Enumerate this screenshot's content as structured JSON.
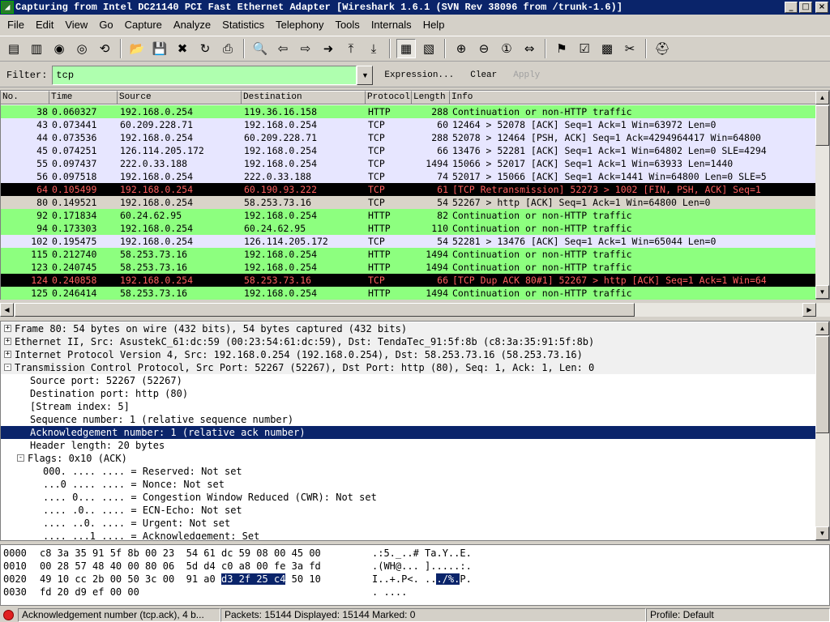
{
  "window": {
    "title": "Capturing from Intel DC21140 PCI Fast Ethernet Adapter   [Wireshark 1.6.1  (SVN Rev 38096 from /trunk-1.6)]",
    "controls": [
      "_",
      "□",
      "×"
    ]
  },
  "menu": [
    "File",
    "Edit",
    "View",
    "Go",
    "Capture",
    "Analyze",
    "Statistics",
    "Telephony",
    "Tools",
    "Internals",
    "Help"
  ],
  "toolbar": {
    "icons": [
      {
        "name": "interfaces-icon",
        "glyph": "▤"
      },
      {
        "name": "capture-options-icon",
        "glyph": "▥"
      },
      {
        "name": "start-capture-icon",
        "glyph": "◉"
      },
      {
        "name": "stop-capture-icon",
        "glyph": "◎"
      },
      {
        "name": "restart-capture-icon",
        "glyph": "⟲"
      },
      {
        "name": "sep"
      },
      {
        "name": "open-file-icon",
        "glyph": "📂"
      },
      {
        "name": "save-file-icon",
        "glyph": "💾"
      },
      {
        "name": "close-file-icon",
        "glyph": "✖"
      },
      {
        "name": "reload-icon",
        "glyph": "↻"
      },
      {
        "name": "print-icon",
        "glyph": "⎙"
      },
      {
        "name": "sep"
      },
      {
        "name": "find-packet-icon",
        "glyph": "🔍"
      },
      {
        "name": "go-back-icon",
        "glyph": "⇦"
      },
      {
        "name": "go-forward-icon",
        "glyph": "⇨"
      },
      {
        "name": "go-to-packet-icon",
        "glyph": "➜"
      },
      {
        "name": "go-first-icon",
        "glyph": "⤒"
      },
      {
        "name": "go-last-icon",
        "glyph": "⤓"
      },
      {
        "name": "sep"
      },
      {
        "name": "colorize-icon",
        "glyph": "▦",
        "active": true
      },
      {
        "name": "auto-scroll-icon",
        "glyph": "▧"
      },
      {
        "name": "sep"
      },
      {
        "name": "zoom-in-icon",
        "glyph": "⊕"
      },
      {
        "name": "zoom-out-icon",
        "glyph": "⊖"
      },
      {
        "name": "zoom-normal-icon",
        "glyph": "①"
      },
      {
        "name": "resize-columns-icon",
        "glyph": "⇔"
      },
      {
        "name": "sep"
      },
      {
        "name": "capture-filters-icon",
        "glyph": "⚑"
      },
      {
        "name": "display-filters-icon",
        "glyph": "☑"
      },
      {
        "name": "coloring-rules-icon",
        "glyph": "▩"
      },
      {
        "name": "preferences-icon",
        "glyph": "✂"
      },
      {
        "name": "sep"
      },
      {
        "name": "help-icon",
        "glyph": "⛑"
      }
    ]
  },
  "filter": {
    "label": "Filter:",
    "value": "tcp",
    "expression": "Expression...",
    "clear": "Clear",
    "apply": "Apply"
  },
  "columns": [
    "No.",
    "Time",
    "Source",
    "Destination",
    "Protocol",
    "Length",
    "Info"
  ],
  "packets": [
    {
      "no": "38",
      "time": "0.060327",
      "src": "192.168.0.254",
      "dst": "119.36.16.158",
      "proto": "HTTP",
      "len": "288",
      "info": "Continuation or non-HTTP traffic",
      "style": "http"
    },
    {
      "no": "43",
      "time": "0.073441",
      "src": "60.209.228.71",
      "dst": "192.168.0.254",
      "proto": "TCP",
      "len": "60",
      "info": "12464 > 52078 [ACK] Seq=1 Ack=1 Win=63972 Len=0",
      "style": "tcp"
    },
    {
      "no": "44",
      "time": "0.073536",
      "src": "192.168.0.254",
      "dst": "60.209.228.71",
      "proto": "TCP",
      "len": "288",
      "info": "52078 > 12464 [PSH, ACK] Seq=1 Ack=4294964417 Win=64800",
      "style": "tcp"
    },
    {
      "no": "45",
      "time": "0.074251",
      "src": "126.114.205.172",
      "dst": "192.168.0.254",
      "proto": "TCP",
      "len": "66",
      "info": "13476 > 52281 [ACK] Seq=1 Ack=1 Win=64802 Len=0 SLE=4294",
      "style": "tcp"
    },
    {
      "no": "55",
      "time": "0.097437",
      "src": "222.0.33.188",
      "dst": "192.168.0.254",
      "proto": "TCP",
      "len": "1494",
      "info": "15066 > 52017 [ACK] Seq=1 Ack=1 Win=63933 Len=1440",
      "style": "tcp"
    },
    {
      "no": "56",
      "time": "0.097518",
      "src": "192.168.0.254",
      "dst": "222.0.33.188",
      "proto": "TCP",
      "len": "74",
      "info": "52017 > 15066 [ACK] Seq=1 Ack=1441 Win=64800 Len=0 SLE=5",
      "style": "tcp"
    },
    {
      "no": "64",
      "time": "0.105499",
      "src": "192.168.0.254",
      "dst": "60.190.93.222",
      "proto": "TCP",
      "len": "61",
      "info": "[TCP Retransmission] 52273 > 1002 [FIN, PSH, ACK] Seq=1",
      "style": "bad"
    },
    {
      "no": "80",
      "time": "0.149521",
      "src": "192.168.0.254",
      "dst": "58.253.73.16",
      "proto": "TCP",
      "len": "54",
      "info": "52267 > http [ACK] Seq=1 Ack=1 Win=64800 Len=0",
      "style": "sel"
    },
    {
      "no": "92",
      "time": "0.171834",
      "src": "60.24.62.95",
      "dst": "192.168.0.254",
      "proto": "HTTP",
      "len": "82",
      "info": "Continuation or non-HTTP traffic",
      "style": "http"
    },
    {
      "no": "94",
      "time": "0.173303",
      "src": "192.168.0.254",
      "dst": "60.24.62.95",
      "proto": "HTTP",
      "len": "110",
      "info": "Continuation or non-HTTP traffic",
      "style": "http"
    },
    {
      "no": "102",
      "time": "0.195475",
      "src": "192.168.0.254",
      "dst": "126.114.205.172",
      "proto": "TCP",
      "len": "54",
      "info": "52281 > 13476 [ACK] Seq=1 Ack=1 Win=65044 Len=0",
      "style": "tcp"
    },
    {
      "no": "115",
      "time": "0.212740",
      "src": "58.253.73.16",
      "dst": "192.168.0.254",
      "proto": "HTTP",
      "len": "1494",
      "info": "Continuation or non-HTTP traffic",
      "style": "http"
    },
    {
      "no": "123",
      "time": "0.240745",
      "src": "58.253.73.16",
      "dst": "192.168.0.254",
      "proto": "HTTP",
      "len": "1494",
      "info": "Continuation or non-HTTP traffic",
      "style": "http"
    },
    {
      "no": "124",
      "time": "0.240858",
      "src": "192.168.0.254",
      "dst": "58.253.73.16",
      "proto": "TCP",
      "len": "66",
      "info": "[TCP Dup ACK 80#1] 52267 > http [ACK] Seq=1 Ack=1 Win=64",
      "style": "bad"
    },
    {
      "no": "125",
      "time": "0.246414",
      "src": "58.253.73.16",
      "dst": "192.168.0.254",
      "proto": "HTTP",
      "len": "1494",
      "info": "Continuation or non-HTTP traffic",
      "style": "http"
    }
  ],
  "details": [
    {
      "text": "Frame 80: 54 bytes on wire (432 bits), 54 bytes captured (432 bits)",
      "level": 0,
      "expander": "+",
      "shade": true
    },
    {
      "text": "Ethernet II, Src: AsustekC_61:dc:59 (00:23:54:61:dc:59), Dst: TendaTec_91:5f:8b (c8:3a:35:91:5f:8b)",
      "level": 0,
      "expander": "+",
      "shade": true
    },
    {
      "text": "Internet Protocol Version 4, Src: 192.168.0.254 (192.168.0.254), Dst: 58.253.73.16 (58.253.73.16)",
      "level": 0,
      "expander": "+",
      "shade": true
    },
    {
      "text": "Transmission Control Protocol, Src Port: 52267 (52267), Dst Port: http (80), Seq: 1, Ack: 1, Len: 0",
      "level": 0,
      "expander": "-",
      "shade": true
    },
    {
      "text": "Source port: 52267 (52267)",
      "level": 1
    },
    {
      "text": "Destination port: http (80)",
      "level": 1
    },
    {
      "text": "[Stream index: 5]",
      "level": 1
    },
    {
      "text": "Sequence number: 1    (relative sequence number)",
      "level": 1
    },
    {
      "text": "Acknowledgement number: 1    (relative ack number)",
      "level": 1,
      "selected": true
    },
    {
      "text": "Header length: 20 bytes",
      "level": 1
    },
    {
      "text": "Flags: 0x10 (ACK)",
      "level": 1,
      "expander": "-"
    },
    {
      "text": "000. .... .... = Reserved: Not set",
      "level": 2
    },
    {
      "text": "...0 .... .... = Nonce: Not set",
      "level": 2
    },
    {
      "text": ".... 0... .... = Congestion Window Reduced (CWR): Not set",
      "level": 2
    },
    {
      "text": ".... .0.. .... = ECN-Echo: Not set",
      "level": 2
    },
    {
      "text": ".... ..0. .... = Urgent: Not set",
      "level": 2
    },
    {
      "text": ".... ...1 .... = Acknowledgement: Set",
      "level": 2
    }
  ],
  "hex": [
    {
      "offset": "0000",
      "bytes_pre": "c8 3a 35 91 5f 8b 00 23  54 61 dc 59 08 00 45 00",
      "bytes_hl": "",
      "bytes_post": "",
      "ascii_pre": ".:5._..# Ta.Y..E.",
      "ascii_hl": "",
      "ascii_post": ""
    },
    {
      "offset": "0010",
      "bytes_pre": "00 28 57 48 40 00 80 06  5d d4 c0 a8 00 fe 3a fd",
      "bytes_hl": "",
      "bytes_post": "",
      "ascii_pre": ".(WH@... ].....:.",
      "ascii_hl": "",
      "ascii_post": ""
    },
    {
      "offset": "0020",
      "bytes_pre": "49 10 cc 2b 00 50 3c 00  91 a0 ",
      "bytes_hl": "d3 2f 25 c4",
      "bytes_post": " 50 10",
      "ascii_pre": "I..+.P<. ..",
      "ascii_hl": "./%.",
      "ascii_post": "P."
    },
    {
      "offset": "0030",
      "bytes_pre": "fd 20 d9 ef 00 00",
      "bytes_hl": "",
      "bytes_post": "",
      "ascii_pre": ". ....",
      "ascii_hl": "",
      "ascii_post": ""
    }
  ],
  "status": {
    "field": "Acknowledgement number (tcp.ack), 4 b...",
    "packets": "Packets: 15144 Displayed: 15144 Marked: 0",
    "profile": "Profile: Default"
  },
  "colors": {
    "titlebar": "#0a246a",
    "filter_valid": "#afffaf",
    "http_row": "#8dff7f",
    "tcp_row": "#e7e6ff",
    "bad_row_bg": "#000000",
    "bad_row_fg": "#ff5f5f",
    "selection": "#0a246a"
  }
}
